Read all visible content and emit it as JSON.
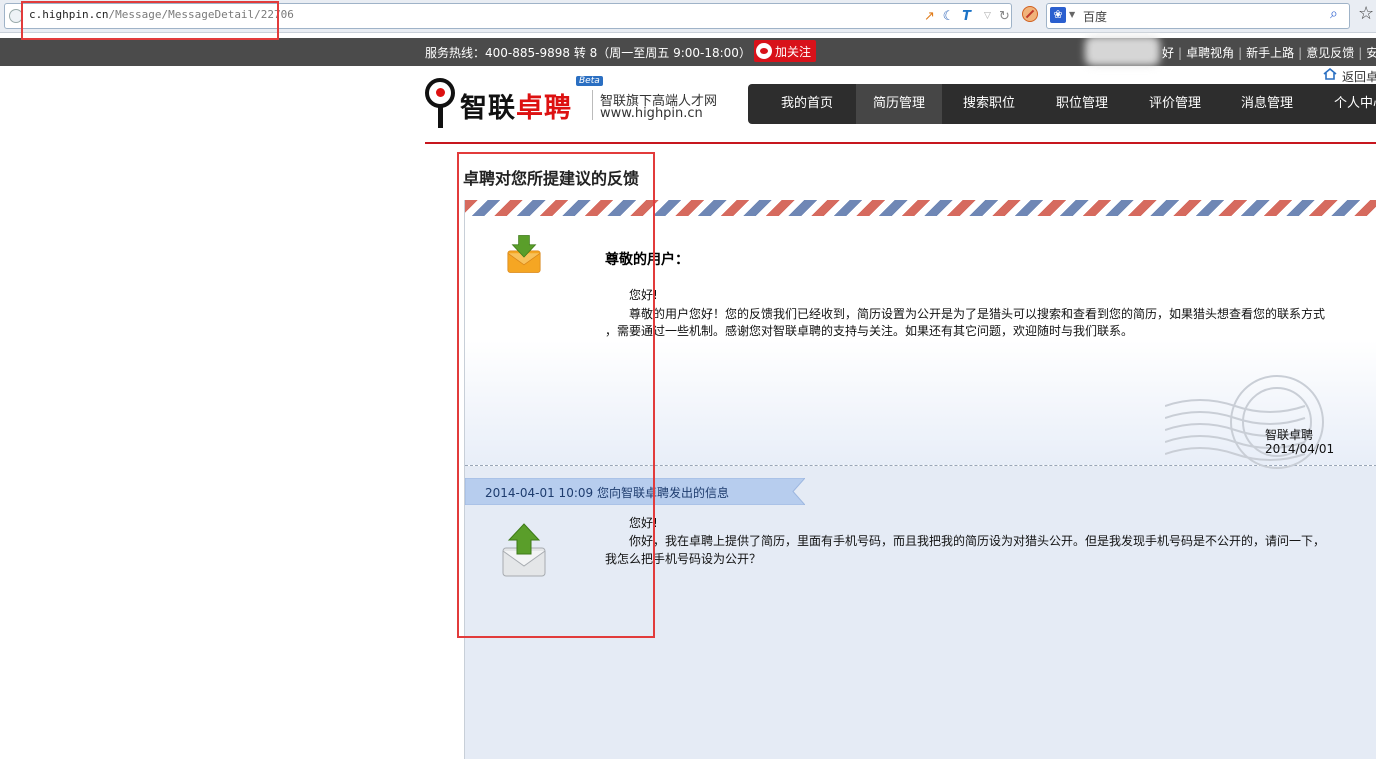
{
  "browser": {
    "url_host": "c.highpin.cn",
    "url_path": "/Message/MessageDetail/22706",
    "search_placeholder": "百度",
    "icons": [
      "page-icon",
      "weather-icon",
      "moon-icon",
      "t-icon",
      "dropdown-icon",
      "refresh-icon",
      "stop-icon",
      "baidu-icon",
      "search-icon",
      "star-icon"
    ]
  },
  "topbar": {
    "hotline": "服务热线：400-885-9898 转 8（周一至周五 9:00-18:00）",
    "weibo_label": "加关注",
    "links": [
      "好",
      "卓聘视角",
      "新手上路",
      "意见反馈",
      "安"
    ]
  },
  "header": {
    "logo_black": "智联",
    "logo_red": "卓聘",
    "beta": "Beta",
    "slogan": "智联旗下高端人才网",
    "site": "www.highpin.cn",
    "back_home": "返回卓"
  },
  "nav": {
    "items": [
      {
        "label": "我的首页",
        "active": false
      },
      {
        "label": "简历管理",
        "active": true
      },
      {
        "label": "搜索职位",
        "active": false
      },
      {
        "label": "职位管理",
        "active": false
      },
      {
        "label": "评价管理",
        "active": false
      },
      {
        "label": "消息管理",
        "active": false
      },
      {
        "label": "个人中心",
        "active": false
      }
    ]
  },
  "page": {
    "title": "卓聘对您所提建议的反馈"
  },
  "reply": {
    "salutation": "尊敬的用户：",
    "hello": "您好!",
    "line1": "尊敬的用户您好！您的反馈我们已经收到，简历设置为公开是为了是猎头可以搜索和查看到您的简历，如果猎头想查看您的联系方式",
    "line2": "，需要通过一些机制。感谢您对智联卓聘的支持与关注。如果还有其它问题，欢迎随时与我们联系。",
    "signature": "智联卓聘",
    "date": "2014/04/01"
  },
  "sent": {
    "header": "2014-04-01 10:09 您向智联卓聘发出的信息",
    "hello": "您好!",
    "line1": "你好，我在卓聘上提供了简历，里面有手机号码，而且我把我的简历设为对猎头公开。但是我发现手机号码是不公开的，请问一下，",
    "line2": "我怎么把手机号码设为公开？"
  },
  "colors": {
    "accent_red": "#c7161e",
    "nav_bg": "#2d2d2d",
    "annotation": "#e23b3b"
  }
}
